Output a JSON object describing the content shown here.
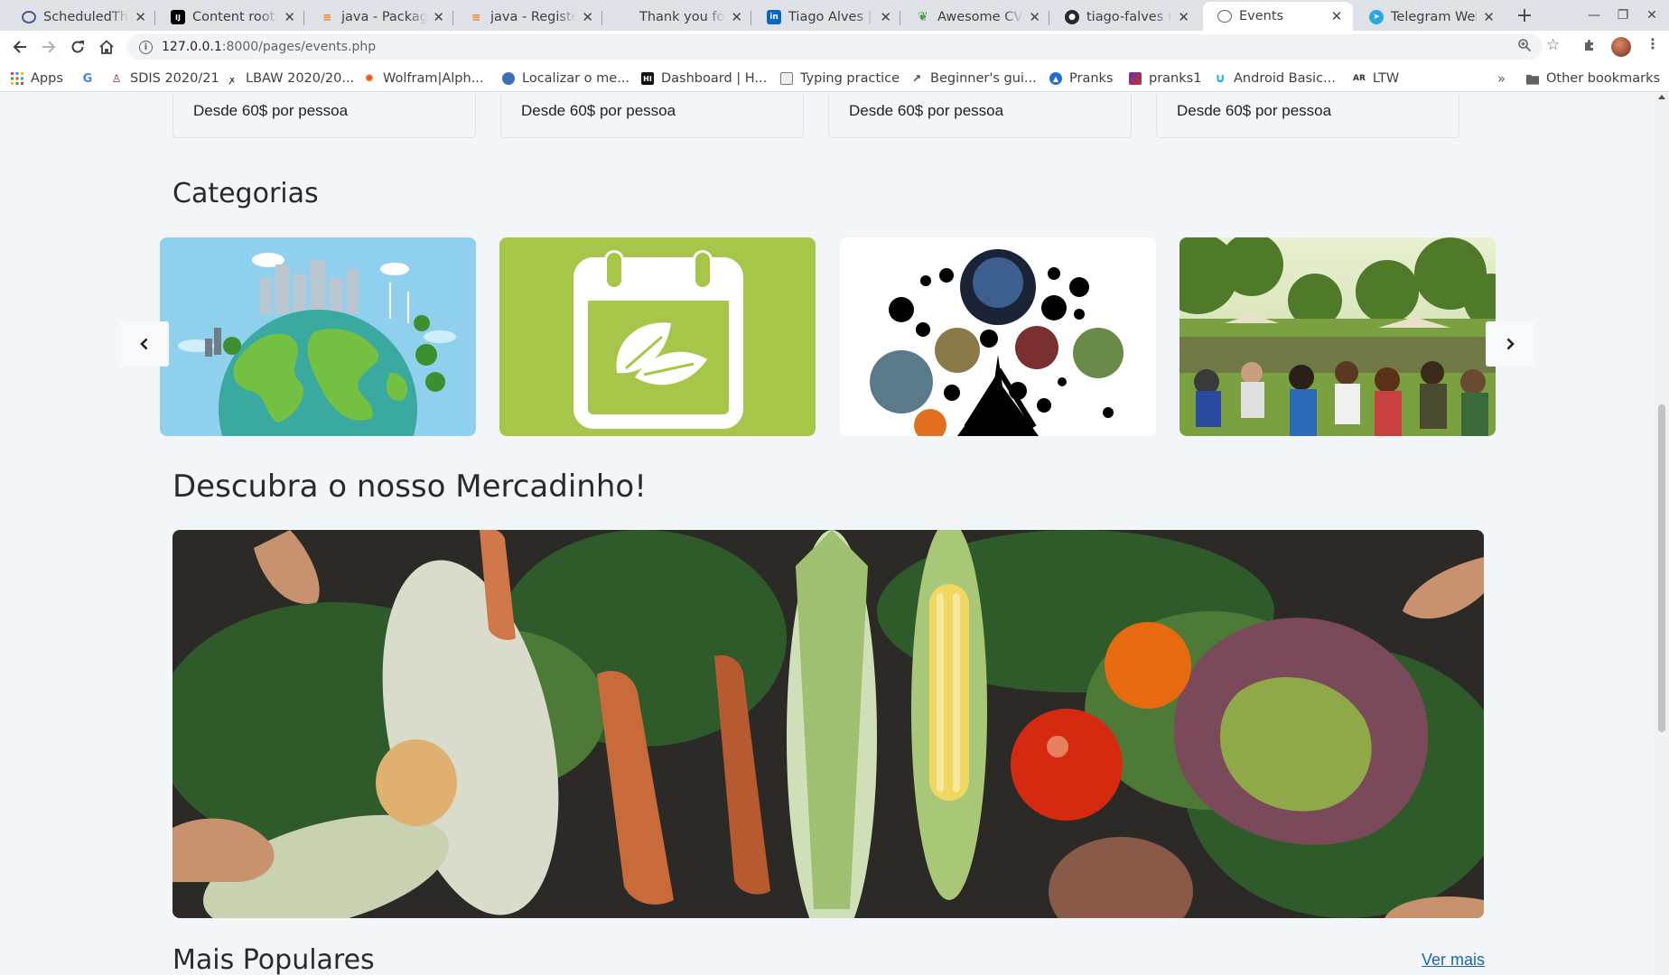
{
  "browser": {
    "tabs": [
      {
        "title": "ScheduledThreadPoolExecutor",
        "icon": "scheduled-icon",
        "active": false
      },
      {
        "title": "Content roots - IntelliJ",
        "icon": "intellij-icon",
        "active": false
      },
      {
        "title": "java - Package does not exist",
        "icon": "stackoverflow-icon",
        "active": false
      },
      {
        "title": "java - Registering RMI",
        "icon": "stackoverflow-icon",
        "active": false
      },
      {
        "title": "Thank you for downloading",
        "icon": "blank-icon",
        "active": false
      },
      {
        "title": "Tiago Alves | LinkedIn",
        "icon": "linkedin-icon",
        "active": false
      },
      {
        "title": "Awesome CV Overleaf",
        "icon": "overleaf-icon",
        "active": false
      },
      {
        "title": "tiago-falves (Tiago Alves)",
        "icon": "github-icon",
        "active": false
      },
      {
        "title": "Events",
        "icon": "globe-icon",
        "active": true
      },
      {
        "title": "Telegram Web",
        "icon": "telegram-icon",
        "active": false
      }
    ],
    "url_host": "127.0.0.1",
    "url_rest": ":8000/pages/events.php",
    "bookmarks": [
      {
        "label": "Apps",
        "icon": "apps-icon"
      },
      {
        "label": "",
        "icon": "google-icon"
      },
      {
        "label": "SDIS 2020/21",
        "icon": "sdis-icon"
      },
      {
        "label": "LBAW 2020/20...",
        "icon": "lbaw-icon"
      },
      {
        "label": "Wolfram|Alph...",
        "icon": "wolfram-icon"
      },
      {
        "label": "Localizar o me...",
        "icon": "globe-icon"
      },
      {
        "label": "Dashboard | H...",
        "icon": "dashboard-icon"
      },
      {
        "label": "Typing practice",
        "icon": "typing-icon"
      },
      {
        "label": "Beginner's gui...",
        "icon": "chart-icon"
      },
      {
        "label": "Pranks",
        "icon": "pranks-icon"
      },
      {
        "label": "pranks1",
        "icon": "pranks1-icon"
      },
      {
        "label": "Android Basic...",
        "icon": "udacity-icon"
      },
      {
        "label": "LTW",
        "icon": "ltw-icon"
      }
    ],
    "other_bookmarks": "Other bookmarks"
  },
  "page": {
    "price_cards": [
      "Desde 60$ por pessoa",
      "Desde 60$ por pessoa",
      "Desde 60$ por pessoa",
      "Desde 60$ por pessoa"
    ],
    "categories_title": "Categorias",
    "categories": [
      {
        "name": "earth-city-category",
        "icon": "earth-city-image"
      },
      {
        "name": "calendar-leaf-category",
        "icon": "calendar-leaf-image"
      },
      {
        "name": "festival-collage-category",
        "icon": "collage-image"
      },
      {
        "name": "outdoor-crowd-category",
        "icon": "crowd-photo"
      }
    ],
    "mercadinho_title": "Descubra o nosso Mercadinho!",
    "popular_title": "Mais Populares",
    "see_more": "Ver mais"
  },
  "colors": {
    "accent_link": "#1a64b4",
    "calendar_green": "#a6c64a",
    "page_bg": "#f3f6f9"
  }
}
